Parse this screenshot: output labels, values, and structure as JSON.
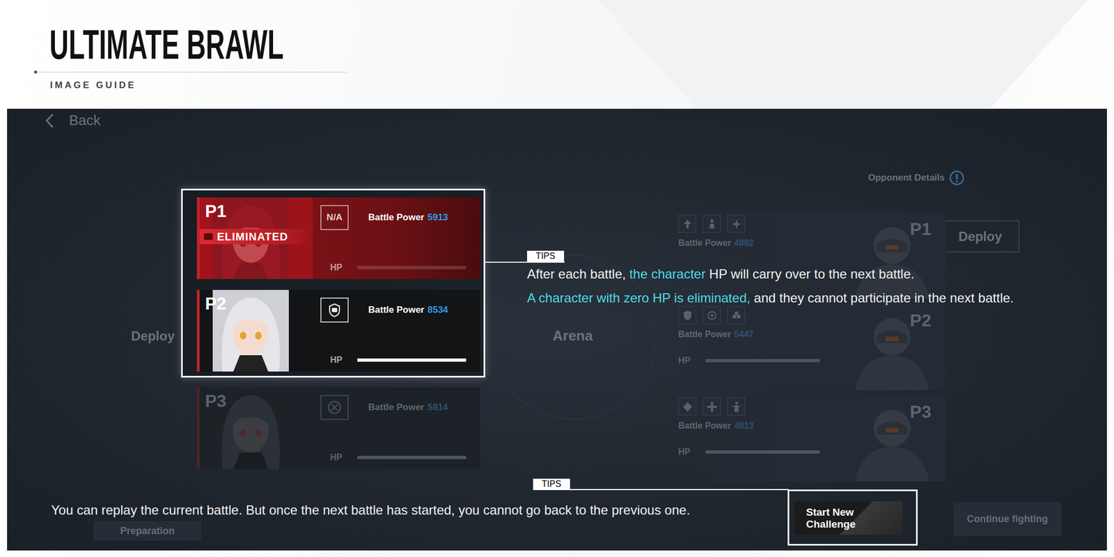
{
  "header": {
    "title": "ULTIMATE BRAWL",
    "subtitle": "IMAGE GUIDE"
  },
  "screen": {
    "back": "Back",
    "opponent_details": "Opponent Details",
    "arena": "Arena",
    "deploy_left": "Deploy",
    "deploy_right": "Deploy",
    "preparation": "Preparation",
    "continue_fighting": "Continue fighting"
  },
  "team": [
    {
      "slot": "P1",
      "highlighted": true,
      "eliminated": true,
      "status": "ELIMINATED",
      "badge": "N/A",
      "battle_power_label": "Battle Power",
      "battle_power": "5913",
      "hp_label": "HP",
      "hp": 0
    },
    {
      "slot": "P2",
      "highlighted": true,
      "eliminated": false,
      "battle_power_label": "Battle Power",
      "battle_power": "8534",
      "hp_label": "HP",
      "hp": 1
    },
    {
      "slot": "P3",
      "highlighted": false,
      "eliminated": false,
      "battle_power_label": "Battle Power",
      "battle_power": "5814",
      "hp_label": "HP",
      "hp": 1
    }
  ],
  "opponents": [
    {
      "slot": "P1",
      "battle_power_label": "Battle Power",
      "battle_power": "4882"
    },
    {
      "slot": "P2",
      "battle_power_label": "Battle Power",
      "battle_power": "5447",
      "hp_label": "HP",
      "hp": 1
    },
    {
      "slot": "P3",
      "battle_power_label": "Battle Power",
      "battle_power": "4813",
      "hp_label": "HP",
      "hp": 1
    }
  ],
  "tips": [
    {
      "label": "TIPS",
      "lines": [
        [
          {
            "text": "After each battle, ",
            "highlight": false
          },
          {
            "text": "the character",
            "highlight": true
          },
          {
            "text": " HP will carry over to the next battle.",
            "highlight": false
          }
        ],
        [
          {
            "text": "A character with zero HP is eliminated,",
            "highlight": true
          },
          {
            "text": " and they cannot participate in the next battle.",
            "highlight": false
          }
        ]
      ]
    },
    {
      "label": "TIPS",
      "lines": [
        [
          {
            "text": "You can replay the current battle. But once the next battle has started, you cannot go back to the previous one.",
            "highlight": false
          }
        ]
      ]
    }
  ],
  "start_button": "Start New Challenge"
}
